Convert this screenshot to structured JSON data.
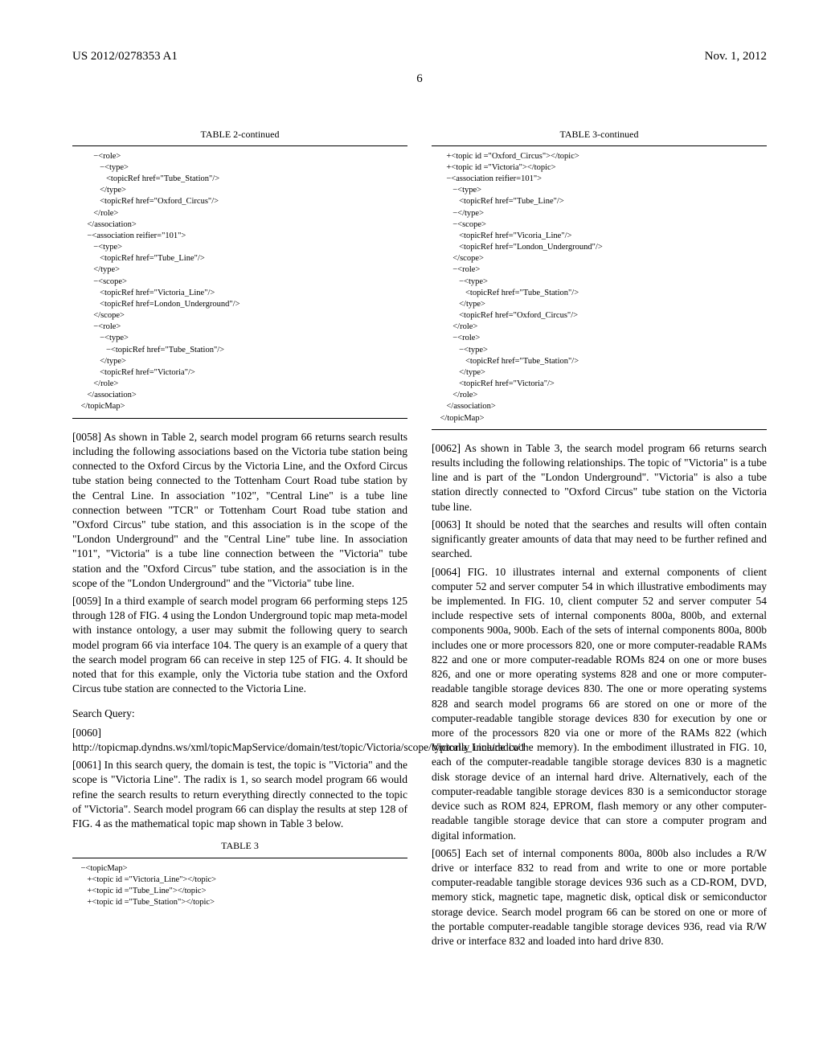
{
  "header": {
    "pub_number": "US 2012/0278353 A1",
    "date": "Nov. 1, 2012",
    "page": "6"
  },
  "left": {
    "table2_title": "TABLE 2-continued",
    "table2_code": "          −<role>\n             −<type>\n                <topicRef href=\"Tube_Station\"/>\n             </type>\n             <topicRef href=\"Oxford_Circus\"/>\n          </role>\n       </association>\n       −<association reifier=\"101\">\n          −<type>\n             <topicRef href=\"Tube_Line\"/>\n          </type>\n          −<scope>\n             <topicRef href=\"Victoria_Line\"/>\n             <topicRef href=London_Underground\"/>\n          </scope>\n          −<role>\n             −<type>\n                −<topicRef href=\"Tube_Station\"/>\n             </type>\n             <topicRef href=\"Victoria\"/>\n          </role>\n       </association>\n    </topicMap>",
    "p0058": "[0058]   As shown in Table 2, search model program 66 returns search results including the following associations based on the Victoria tube station being connected to the Oxford Circus by the Victoria Line, and the Oxford Circus tube station being connected to the Tottenham Court Road tube station by the Central Line. In association \"102\", \"Central Line\" is a tube line connection between \"TCR\" or Tottenham Court Road tube station and \"Oxford Circus\" tube station, and this association is in the scope of the \"London Underground\" and the \"Central Line\" tube line. In association \"101\", \"Victoria\" is a tube line connection between the \"Victoria\" tube station and the \"Oxford Circus\" tube station, and the association is in the scope of the \"London Underground\" and the \"Victoria\" tube line.",
    "p0059": "[0059]   In a third example of search model program 66 performing steps 125 through 128 of FIG. 4 using the London Underground topic map meta-model with instance ontology, a user may submit the following query to search model program 66 via interface 104. The query is an example of a query that the search model program 66 can receive in step 125 of FIG. 4. It should be noted that for this example, only the Victoria tube station and the Oxford Circus tube station are connected to the Victoria Line.",
    "search_query_heading": "Search Query:",
    "p0060": "[0060]   http://topicmap.dyndns.ws/xml/topicMapService/domain/test/topic/Victoria/scope/Victoria_Line/radix/1",
    "p0061": "[0061]   In this search query, the domain is test, the topic is \"Victoria\" and the scope is \"Victoria Line\". The radix is 1, so search model program 66 would refine the search results to return everything directly connected to the topic of \"Victoria\". Search model program 66 can display the results at step 128 of FIG. 4 as the mathematical topic map shown in Table 3 below.",
    "table3_title": "TABLE 3",
    "table3_code": "    −<topicMap>\n       +<topic id =\"Victoria_Line\"></topic>\n       +<topic id =\"Tube_Line\"></topic>\n       +<topic id =\"Tube_Station\"></topic>"
  },
  "right": {
    "table3c_title": "TABLE 3-continued",
    "table3c_code": "       +<topic id =\"Oxford_Circus\"></topic>\n       +<topic id =\"Victoria\"></topic>\n       −<association reifier=101\">\n          −<type>\n             <topicRef href=\"Tube_Line\"/>\n          −</type>\n          −<scope>\n             <topicRef href=\"Vicoria_Line\"/>\n             <topicRef href=\"London_Underground\"/>\n          </scope>\n          −<role>\n             −<type>\n                <topicRef href=\"Tube_Station\"/>\n             </type>\n             <topicRef href=\"Oxford_Circus\"/>\n          </role>\n          −<role>\n             −<type>\n                <topicRef href=\"Tube_Station\"/>\n             </type>\n             <topicRef href=\"Victoria\"/>\n          </role>\n       </association>\n    </topicMap>",
    "p0062": "[0062]   As shown in Table 3, the search model program 66 returns search results including the following relationships. The topic of \"Victoria\" is a tube line and is part of the \"London Underground\". \"Victoria\" is also a tube station directly connected to \"Oxford Circus\" tube station on the Victoria tube line.",
    "p0063": "[0063]   It should be noted that the searches and results will often contain significantly greater amounts of data that may need to be further refined and searched.",
    "p0064": "[0064]   FIG. 10 illustrates internal and external components of client computer 52 and server computer 54 in which illustrative embodiments may be implemented. In FIG. 10, client computer 52 and server computer 54 include respective sets of internal components 800a, 800b, and external components 900a, 900b. Each of the sets of internal components 800a, 800b includes one or more processors 820, one or more computer-readable RAMs 822 and one or more computer-readable ROMs 824 on one or more buses 826, and one or more operating systems 828 and one or more computer-readable tangible storage devices 830. The one or more operating systems 828 and search model programs 66 are stored on one or more of the computer-readable tangible storage devices 830 for execution by one or more of the processors 820 via one or more of the RAMs 822 (which typically include cache memory). In the embodiment illustrated in FIG. 10, each of the computer-readable tangible storage devices 830 is a magnetic disk storage device of an internal hard drive. Alternatively, each of the computer-readable tangible storage devices 830 is a semiconductor storage device such as ROM 824, EPROM, flash memory or any other computer-readable tangible storage device that can store a computer program and digital information.",
    "p0065": "[0065]   Each set of internal components 800a, 800b also includes a R/W drive or interface 832 to read from and write to one or more portable computer-readable tangible storage devices 936 such as a CD-ROM, DVD, memory stick, magnetic tape, magnetic disk, optical disk or semiconductor storage device. Search model program 66 can be stored on one or more of the portable computer-readable tangible storage devices 936, read via R/W drive or interface 832 and loaded into hard drive 830."
  }
}
